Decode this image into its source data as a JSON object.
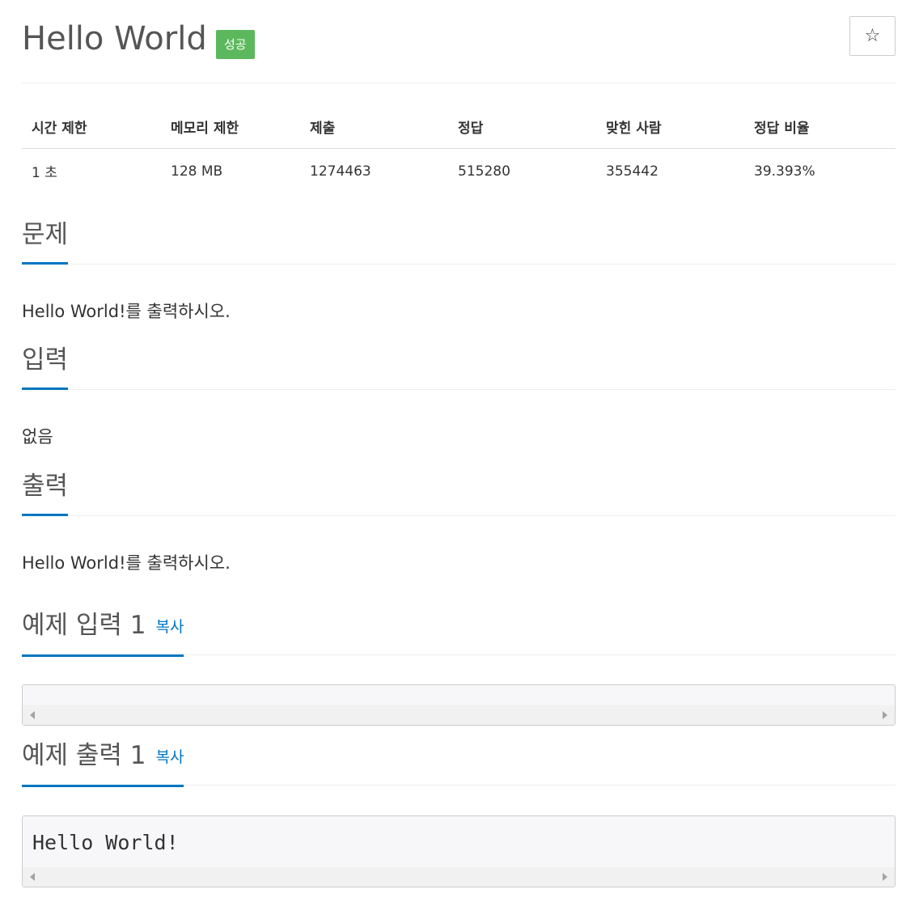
{
  "problem": {
    "title": "Hello World",
    "status_badge": "성공",
    "star_icon": "☆"
  },
  "info": {
    "headers": [
      "시간 제한",
      "메모리 제한",
      "제출",
      "정답",
      "맞힌 사람",
      "정답 비율"
    ],
    "values": [
      "1 초",
      "128 MB",
      "1274463",
      "515280",
      "355442",
      "39.393%"
    ]
  },
  "sections": {
    "description": {
      "title": "문제",
      "text": "Hello World!를 출력하시오."
    },
    "input": {
      "title": "입력",
      "text": "없음"
    },
    "output": {
      "title": "출력",
      "text": "Hello World!를 출력하시오."
    },
    "sample_input": {
      "title": "예제 입력 1",
      "copy_label": "복사",
      "content": ""
    },
    "sample_output": {
      "title": "예제 출력 1",
      "copy_label": "복사",
      "content": "Hello World!"
    }
  },
  "colors": {
    "accent": "#0076c0",
    "success": "#5cb85c"
  }
}
